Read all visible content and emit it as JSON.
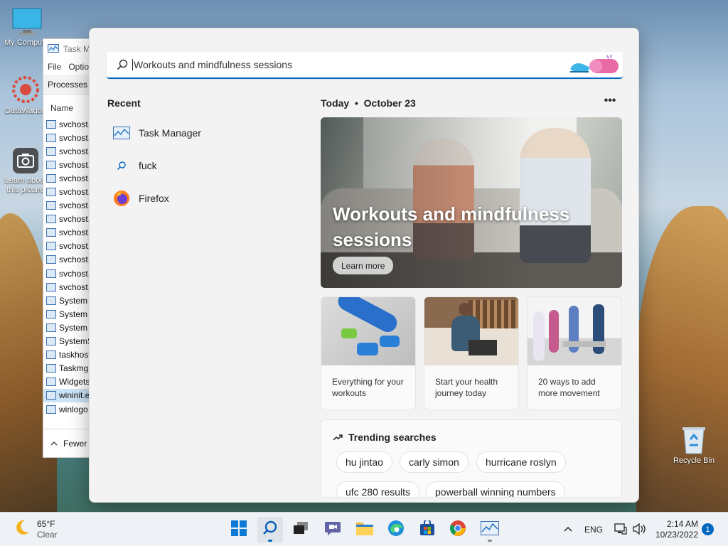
{
  "desktop": {
    "icons": [
      {
        "name": "my-computer",
        "label": "My Computer"
      },
      {
        "name": "datawagon",
        "label": "DataWagon"
      },
      {
        "name": "learn-about-picture",
        "label": "Learn about this picture"
      },
      {
        "name": "recycle-bin",
        "label": "Recycle Bin"
      }
    ]
  },
  "task_manager": {
    "title": "Task M",
    "menu": [
      "File",
      "Optio"
    ],
    "tab": "Processes",
    "column": "Name",
    "processes": [
      "svchost.",
      "svchost.",
      "svchost.",
      "svchost.",
      "svchost.",
      "svchost.",
      "svchost.",
      "svchost.",
      "svchost.",
      "svchost.",
      "svchost.",
      "svchost.",
      "svchost.",
      "System",
      "System",
      "System",
      "SystemS",
      "taskhost",
      "Taskmgr",
      "Widgets",
      "wininit.e",
      "winlogo"
    ],
    "fewer_label": "Fewer"
  },
  "search": {
    "query": "Workouts and mindfulness sessions"
  },
  "recent": {
    "title": "Recent",
    "items": [
      {
        "label": "Task Manager",
        "icon": "task-manager-icon"
      },
      {
        "label": "fuck",
        "icon": "search-icon"
      },
      {
        "label": "Firefox",
        "icon": "firefox-icon"
      }
    ]
  },
  "today": {
    "heading": "Today  •  October 23",
    "hero_title": "Workouts and mindfulness sessions",
    "hero_button": "Learn more",
    "cards": [
      {
        "text": "Everything for your workouts"
      },
      {
        "text": "Start your health journey today"
      },
      {
        "text": "20 ways to add more movement"
      }
    ]
  },
  "trending": {
    "title": "Trending searches",
    "chips": [
      "hu jintao",
      "carly simon",
      "hurricane roslyn",
      "ufc 280 results",
      "powerball winning numbers"
    ]
  },
  "taskbar": {
    "weather_temp": "65°F",
    "weather_desc": "Clear",
    "lang": "ENG",
    "time": "2:14 AM",
    "date": "10/23/2022",
    "notifications": "1",
    "accent": "#0067c0"
  }
}
